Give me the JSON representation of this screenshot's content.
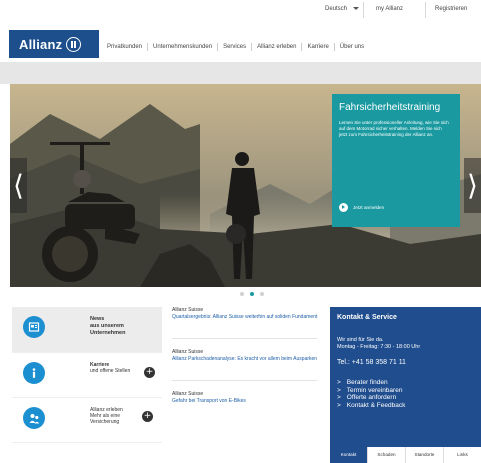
{
  "topbar": {
    "language": "Deutsch",
    "my_allianz": "my Allianz",
    "register": "Registrieren"
  },
  "header": {
    "logo_text": "Allianz",
    "nav": [
      "Privatkunden",
      "Unternehmenskunden",
      "Services",
      "Allianz erleben",
      "Karriere",
      "Über uns"
    ]
  },
  "hero": {
    "teaser_title": "Fahrsicherheitstraining",
    "teaser_body": "Lernen Sie unter professioneller Anleitung, wie Sie sich auf dem Motorrad sicher verhalten. Melden Sie sich jetzt zum Fahrsicherheitstraining der Allianz an.",
    "teaser_cta": "Jetzt anmelden",
    "prev_arrow": "⟨",
    "next_arrow": "⟩",
    "slide_index": 1,
    "slide_count": 3
  },
  "features": [
    {
      "icon": "newspaper-icon",
      "line1": "News",
      "line2": "aus unserem",
      "line3": "Unternehmen"
    },
    {
      "icon": "info-icon",
      "line1": "Karriere",
      "line2": "und offene Stellen",
      "line3": ""
    },
    {
      "icon": "people-icon",
      "line1": "Allianz erleben",
      "line2": "Mehr als eine",
      "line3": "Versicherung"
    }
  ],
  "news": [
    {
      "kicker": "Allianz Suisse",
      "title": "Quartalsergebnis: Allianz Suisse weiterhin auf soliden Fundament"
    },
    {
      "kicker": "Allianz Suisse",
      "title": "Allianz Parkschadenanalyse: Es kracht vor allem beim Ausparken"
    },
    {
      "kicker": "Allianz Suisse",
      "title": "Gefahr bei Transport von E-Bikes"
    }
  ],
  "contact": {
    "title": "Kontakt & Service",
    "line1": "Wir sind für Sie da.",
    "line2": "Montag - Freitag: 7:30 - 18:00 Uhr",
    "phone": "Tel.: +41 58 358 71 11",
    "links": [
      "Berater finden",
      "Termin vereinbaren",
      "Offerte anfordern",
      "Kontakt & Feedback"
    ],
    "tabs": [
      "Kontakt",
      "Schaden",
      "Standorte",
      "Links"
    ]
  },
  "colors": {
    "brand_blue": "#1c4f8c",
    "teaser_teal": "#1a9aa0",
    "icon_blue": "#1c8fd1",
    "link_blue": "#1c5ea8"
  }
}
